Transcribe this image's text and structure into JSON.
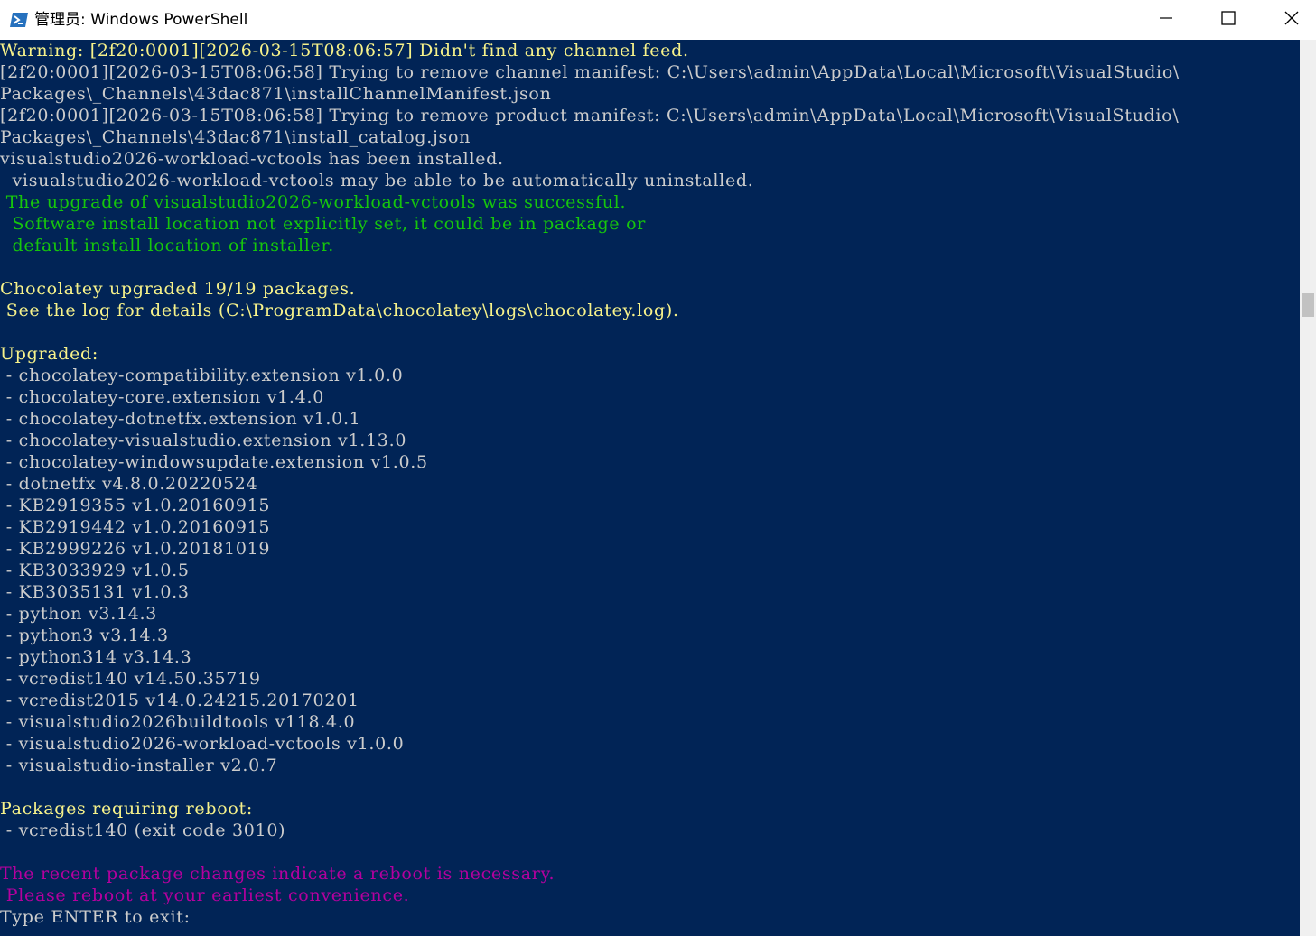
{
  "window": {
    "title": "管理员: Windows PowerShell",
    "icon": "powershell-icon",
    "controls": [
      "minimize-icon",
      "maximize-icon",
      "close-icon"
    ]
  },
  "colors": {
    "console_bg": "#012456",
    "default_text": "#cccccc",
    "warning_text": "#f7f28a",
    "success_text": "#16c60c",
    "reboot_text": "#b4009e"
  },
  "console": {
    "lines": [
      {
        "text": "Warning: [2f20:0001][2026-03-15T08:06:57] Didn't find any channel feed.",
        "color": "yellow"
      },
      {
        "text": "[2f20:0001][2026-03-15T08:06:58] Trying to remove channel manifest: C:\\Users\\admin\\AppData\\Local\\Microsoft\\VisualStudio\\",
        "color": "default"
      },
      {
        "text": "Packages\\_Channels\\43dac871\\installChannelManifest.json",
        "color": "default"
      },
      {
        "text": "[2f20:0001][2026-03-15T08:06:58] Trying to remove product manifest: C:\\Users\\admin\\AppData\\Local\\Microsoft\\VisualStudio\\",
        "color": "default"
      },
      {
        "text": "Packages\\_Channels\\43dac871\\install_catalog.json",
        "color": "default"
      },
      {
        "text": "visualstudio2026-workload-vctools has been installed.",
        "color": "default"
      },
      {
        "text": "  visualstudio2026-workload-vctools may be able to be automatically uninstalled.",
        "color": "default"
      },
      {
        "text": " The upgrade of visualstudio2026-workload-vctools was successful.",
        "color": "green"
      },
      {
        "text": "  Software install location not explicitly set, it could be in package or",
        "color": "green"
      },
      {
        "text": "  default install location of installer.",
        "color": "green"
      },
      {
        "text": "",
        "color": "default"
      },
      {
        "text": "Chocolatey upgraded 19/19 packages.",
        "color": "yellow"
      },
      {
        "text": " See the log for details (C:\\ProgramData\\chocolatey\\logs\\chocolatey.log).",
        "color": "yellow"
      },
      {
        "text": "",
        "color": "default"
      },
      {
        "text": "Upgraded:",
        "color": "yellow"
      },
      {
        "text": " - chocolatey-compatibility.extension v1.0.0",
        "color": "default"
      },
      {
        "text": " - chocolatey-core.extension v1.4.0",
        "color": "default"
      },
      {
        "text": " - chocolatey-dotnetfx.extension v1.0.1",
        "color": "default"
      },
      {
        "text": " - chocolatey-visualstudio.extension v1.13.0",
        "color": "default"
      },
      {
        "text": " - chocolatey-windowsupdate.extension v1.0.5",
        "color": "default"
      },
      {
        "text": " - dotnetfx v4.8.0.20220524",
        "color": "default"
      },
      {
        "text": " - KB2919355 v1.0.20160915",
        "color": "default"
      },
      {
        "text": " - KB2919442 v1.0.20160915",
        "color": "default"
      },
      {
        "text": " - KB2999226 v1.0.20181019",
        "color": "default"
      },
      {
        "text": " - KB3033929 v1.0.5",
        "color": "default"
      },
      {
        "text": " - KB3035131 v1.0.3",
        "color": "default"
      },
      {
        "text": " - python v3.14.3",
        "color": "default"
      },
      {
        "text": " - python3 v3.14.3",
        "color": "default"
      },
      {
        "text": " - python314 v3.14.3",
        "color": "default"
      },
      {
        "text": " - vcredist140 v14.50.35719",
        "color": "default"
      },
      {
        "text": " - vcredist2015 v14.0.24215.20170201",
        "color": "default"
      },
      {
        "text": " - visualstudio2026buildtools v118.4.0",
        "color": "default"
      },
      {
        "text": " - visualstudio2026-workload-vctools v1.0.0",
        "color": "default"
      },
      {
        "text": " - visualstudio-installer v2.0.7",
        "color": "default"
      },
      {
        "text": "",
        "color": "default"
      },
      {
        "text": "Packages requiring reboot:",
        "color": "yellow"
      },
      {
        "text": " - vcredist140 (exit code 3010)",
        "color": "default"
      },
      {
        "text": "",
        "color": "default"
      },
      {
        "text": "The recent package changes indicate a reboot is necessary.",
        "color": "magenta"
      },
      {
        "text": " Please reboot at your earliest convenience.",
        "color": "magenta"
      },
      {
        "text": "Type ENTER to exit:",
        "color": "default"
      }
    ]
  }
}
